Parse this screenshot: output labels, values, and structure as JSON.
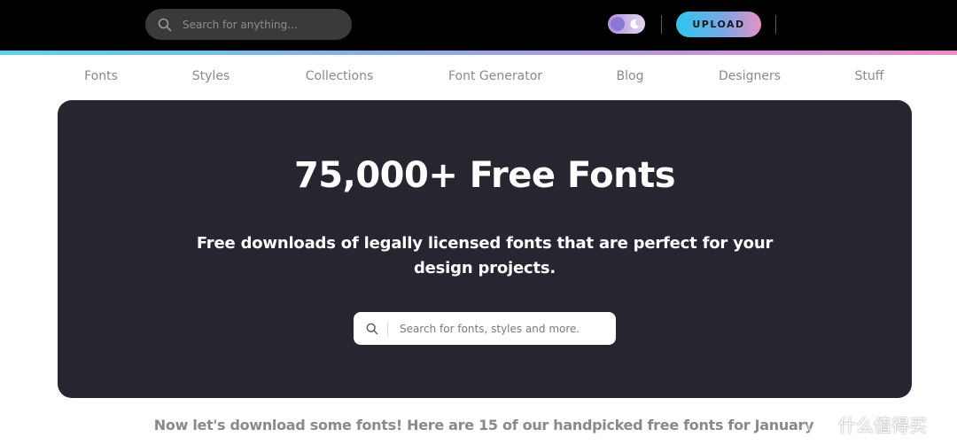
{
  "header": {
    "search": {
      "placeholder": "Search for anything..."
    },
    "upload_label": "UPLOAD",
    "theme_toggle": {
      "state": "dark"
    }
  },
  "nav": {
    "items": [
      {
        "label": "Fonts"
      },
      {
        "label": "Styles"
      },
      {
        "label": "Collections"
      },
      {
        "label": "Font Generator"
      },
      {
        "label": "Blog"
      },
      {
        "label": "Designers"
      },
      {
        "label": "Stuff"
      }
    ]
  },
  "hero": {
    "title": "75,000+ Free Fonts",
    "subtitle": "Free downloads of legally licensed fonts that are perfect for your design projects.",
    "search": {
      "placeholder": "Search for fonts, styles and more."
    }
  },
  "tagline": "Now let's download some fonts! Here are 15 of our handpicked free fonts for January",
  "watermark": {
    "text": "什么值得买",
    "glyph": "值"
  },
  "colors": {
    "topbar": "#000000",
    "hero_bg": "#27252f",
    "accent_gradient_start": "#2bc7ed",
    "accent_gradient_end": "#e691c6",
    "nav_text": "#8a8a8a"
  },
  "icons": {
    "top_search": "search-icon",
    "hero_search": "search-icon",
    "theme": "moon-icon"
  }
}
